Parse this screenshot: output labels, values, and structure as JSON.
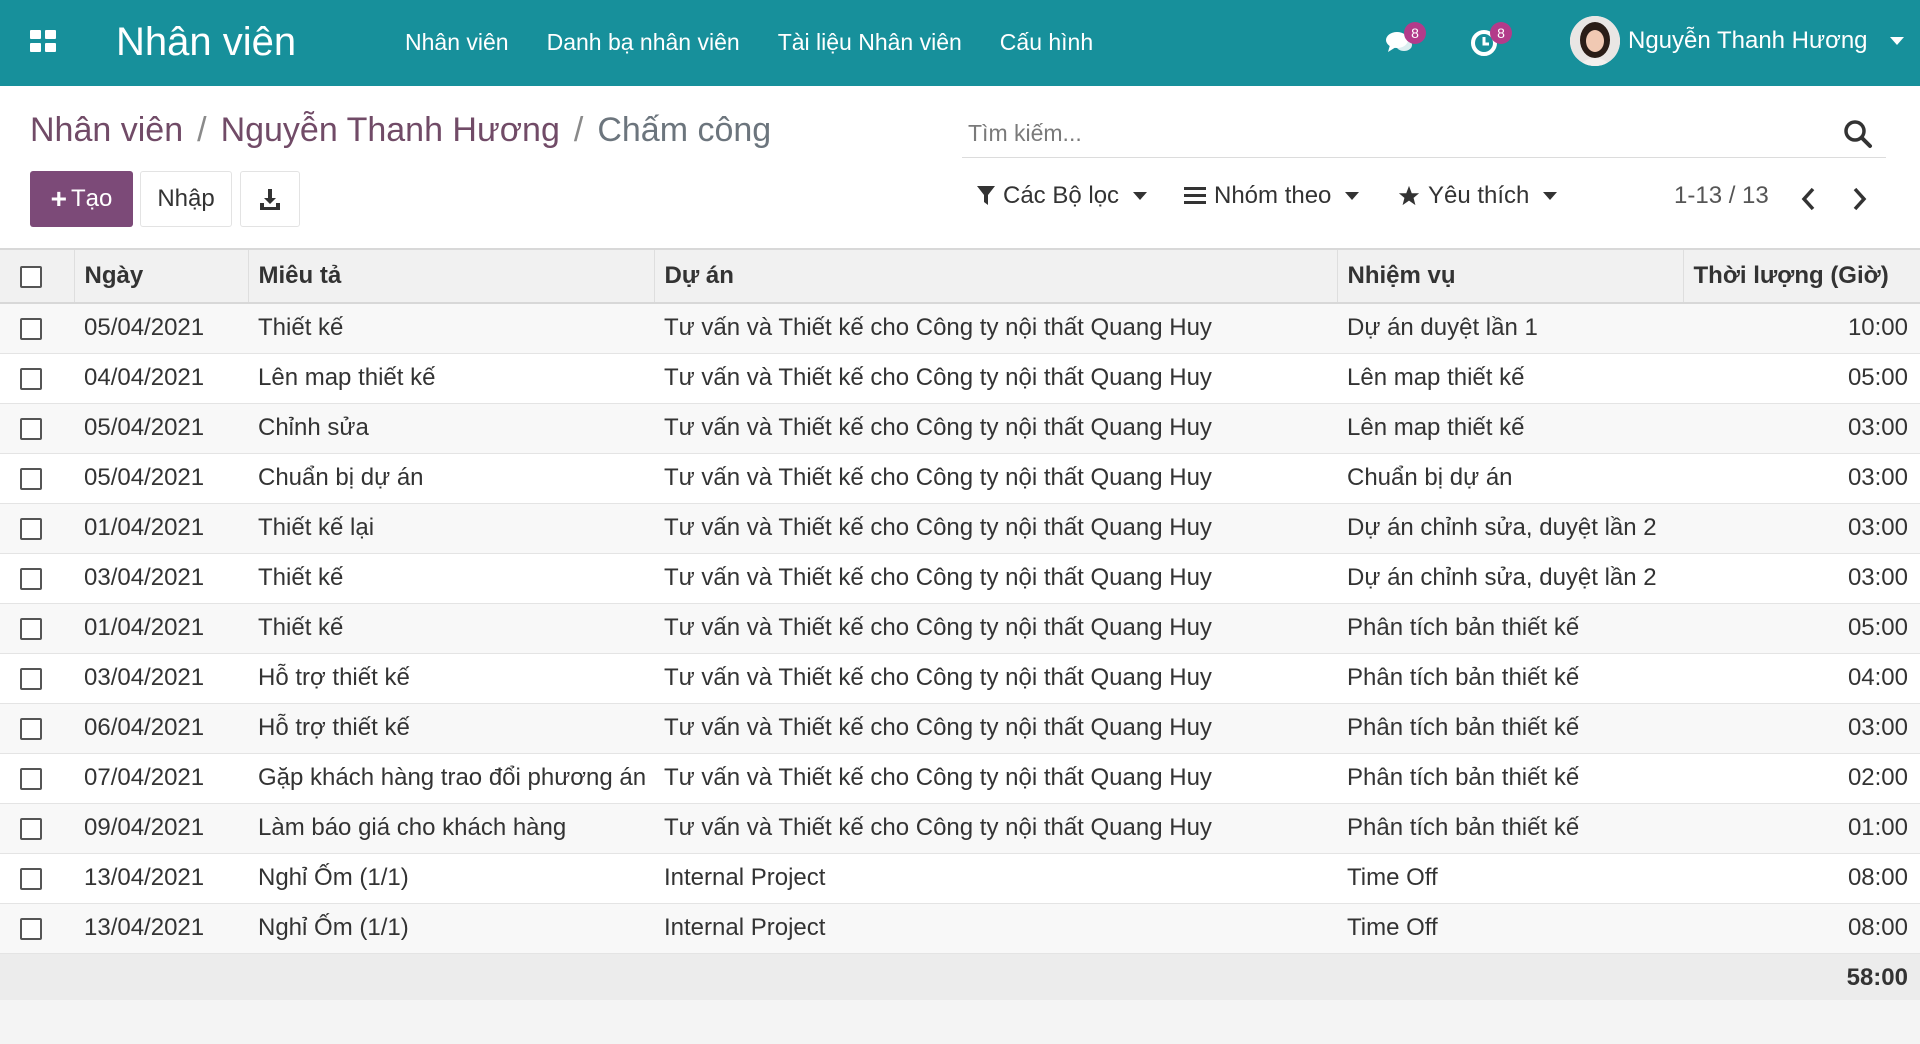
{
  "navbar": {
    "app_title": "Nhân viên",
    "menu": [
      "Nhân viên",
      "Danh bạ nhân viên",
      "Tài liệu Nhân viên",
      "Cấu hình"
    ],
    "messages_count": "8",
    "activities_count": "8",
    "user_name": "Nguyễn Thanh Hương",
    "icons": [
      "apps-grid-icon",
      "chat-icon",
      "clock-icon",
      "chevron-down-icon"
    ]
  },
  "breadcrumb": {
    "items": [
      "Nhân viên",
      "Nguyễn Thanh Hương"
    ],
    "current": "Chấm công",
    "separator": "/"
  },
  "search": {
    "placeholder": "Tìm kiếm..."
  },
  "buttons": {
    "create": "Tạo",
    "create_icon": "+",
    "import": "Nhập"
  },
  "filters": {
    "filters_label": "Các Bộ lọc",
    "group_by_label": "Nhóm theo",
    "favorites_label": "Yêu thích"
  },
  "pager": {
    "value": "1-13 / 13"
  },
  "table": {
    "headers": [
      "Ngày",
      "Miêu tả",
      "Dự án",
      "Nhiệm vụ",
      "Thời lượng (Giờ)"
    ],
    "rows": [
      [
        "05/04/2021",
        "Thiết kế",
        "Tư vấn và Thiết kế cho Công ty nội thất Quang Huy",
        "Dự án duyệt lần 1",
        "10:00"
      ],
      [
        "04/04/2021",
        "Lên map thiết kế",
        "Tư vấn và Thiết kế cho Công ty nội thất Quang Huy",
        "Lên map thiết kế",
        "05:00"
      ],
      [
        "05/04/2021",
        "Chỉnh sửa",
        "Tư vấn và Thiết kế cho Công ty nội thất Quang Huy",
        "Lên map thiết kế",
        "03:00"
      ],
      [
        "05/04/2021",
        "Chuẩn bị dự án",
        "Tư vấn và Thiết kế cho Công ty nội thất Quang Huy",
        "Chuẩn bị dự án",
        "03:00"
      ],
      [
        "01/04/2021",
        "Thiết kế lại",
        "Tư vấn và Thiết kế cho Công ty nội thất Quang Huy",
        "Dự án chỉnh sửa, duyệt lần 2",
        "03:00"
      ],
      [
        "03/04/2021",
        "Thiết kế",
        "Tư vấn và Thiết kế cho Công ty nội thất Quang Huy",
        "Dự án chỉnh sửa, duyệt lần 2",
        "03:00"
      ],
      [
        "01/04/2021",
        "Thiết kế",
        "Tư vấn và Thiết kế cho Công ty nội thất Quang Huy",
        "Phân tích bản thiết kế",
        "05:00"
      ],
      [
        "03/04/2021",
        "Hỗ trợ thiết kế",
        "Tư vấn và Thiết kế cho Công ty nội thất Quang Huy",
        "Phân tích bản thiết kế",
        "04:00"
      ],
      [
        "06/04/2021",
        "Hỗ trợ thiết kế",
        "Tư vấn và Thiết kế cho Công ty nội thất Quang Huy",
        "Phân tích bản thiết kế",
        "03:00"
      ],
      [
        "07/04/2021",
        "Gặp khách hàng trao đổi phương án",
        "Tư vấn và Thiết kế cho Công ty nội thất Quang Huy",
        "Phân tích bản thiết kế",
        "02:00"
      ],
      [
        "09/04/2021",
        "Làm báo giá cho khách hàng",
        "Tư vấn và Thiết kế cho Công ty nội thất Quang Huy",
        "Phân tích bản thiết kế",
        "01:00"
      ],
      [
        "13/04/2021",
        "Nghỉ Ốm (1/1)",
        "Internal Project",
        "Time Off",
        "08:00"
      ],
      [
        "13/04/2021",
        "Nghỉ Ốm (1/1)",
        "Internal Project",
        "Time Off",
        "08:00"
      ]
    ],
    "total": "58:00"
  },
  "colors": {
    "navbar": "#17909b",
    "primary_button": "#7c4a78",
    "breadcrumb_link": "#714b67",
    "badge": "#b33b8a"
  }
}
